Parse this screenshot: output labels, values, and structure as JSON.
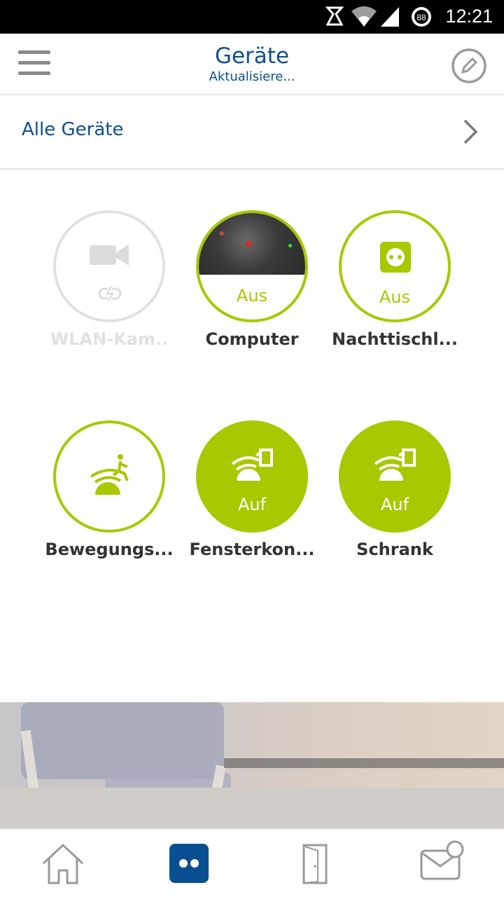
{
  "status_bar": {
    "time": "12:21",
    "battery_level": "88"
  },
  "header": {
    "title": "Geräte",
    "subtitle": "Aktualisiere..."
  },
  "all_devices": {
    "label": "Alle Geräte"
  },
  "devices": [
    {
      "name": "WLAN-Kam..",
      "state": "",
      "icon": "video-camera-icon",
      "status": "inactive"
    },
    {
      "name": "Computer",
      "state": "Aus",
      "icon": "camera-snapshot",
      "status": "outline"
    },
    {
      "name": "Nachttischl...",
      "state": "Aus",
      "icon": "power-socket-icon",
      "status": "outline"
    },
    {
      "name": "Bewegungs...",
      "state": "",
      "icon": "motion-sensor-icon",
      "status": "outline"
    },
    {
      "name": "Fensterkon...",
      "state": "Auf",
      "icon": "window-contact-icon",
      "status": "filled"
    },
    {
      "name": "Schrank",
      "state": "Auf",
      "icon": "window-contact-icon",
      "status": "filled"
    }
  ],
  "bottom_nav": [
    "home-icon",
    "devices-icon",
    "door-icon",
    "messages-icon"
  ],
  "colors": {
    "accent": "#a8c800",
    "brand_blue": "#0b4f93",
    "inactive": "#e1e1e1"
  }
}
